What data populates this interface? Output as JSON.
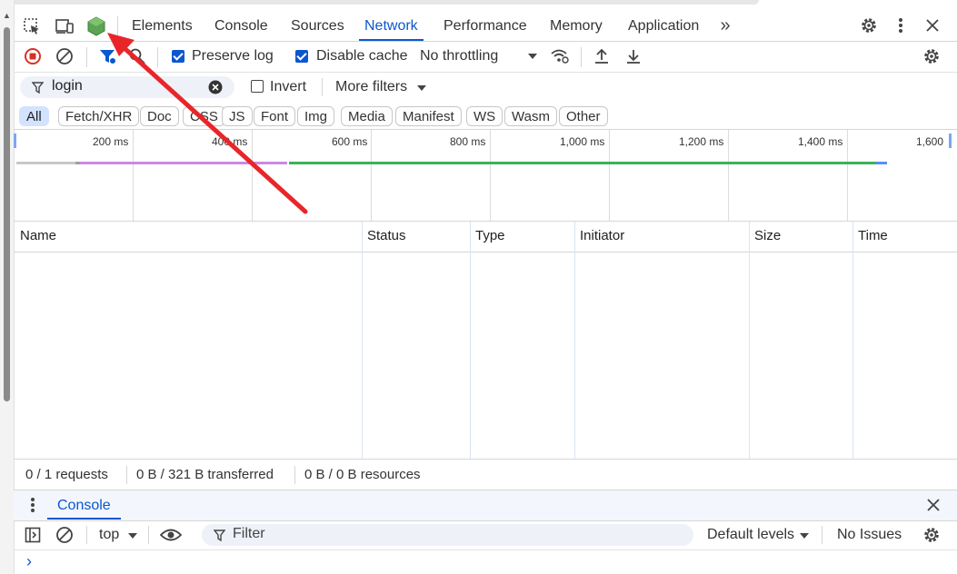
{
  "tabs": [
    "Elements",
    "Console",
    "Sources",
    "Network",
    "Performance",
    "Memory",
    "Application"
  ],
  "active_tab": "Network",
  "toolbar": {
    "preserve_log_label": "Preserve log",
    "preserve_log_checked": true,
    "disable_cache_label": "Disable cache",
    "disable_cache_checked": true,
    "throttling_value": "No throttling"
  },
  "filter": {
    "value": "login",
    "invert_label": "Invert",
    "invert_checked": false,
    "more_filters_label": "More filters"
  },
  "type_filters": [
    "All",
    "Fetch/XHR",
    "Doc",
    "CSS",
    "JS",
    "Font",
    "Img",
    "Media",
    "Manifest",
    "WS",
    "Wasm",
    "Other"
  ],
  "active_type_filter": "All",
  "timeline_ticks": [
    "200 ms",
    "400 ms",
    "600 ms",
    "800 ms",
    "1,000 ms",
    "1,200 ms",
    "1,400 ms",
    "1,600"
  ],
  "table": {
    "columns": [
      "Name",
      "Status",
      "Type",
      "Initiator",
      "Size",
      "Time"
    ],
    "rows": []
  },
  "status": {
    "requests": "0 / 1 requests",
    "transferred": "0 B / 321 B transferred",
    "resources": "0 B / 0 B resources"
  },
  "drawer": {
    "tab_label": "Console",
    "context": "top",
    "filter_placeholder": "Filter",
    "levels": "Default levels",
    "issues": "No Issues",
    "prompt": "›"
  },
  "colors": {
    "accent": "#0b57d0",
    "record_stop": "#d93025",
    "node_icon": "#5aa454",
    "annotation_arrow": "#e8262a"
  }
}
